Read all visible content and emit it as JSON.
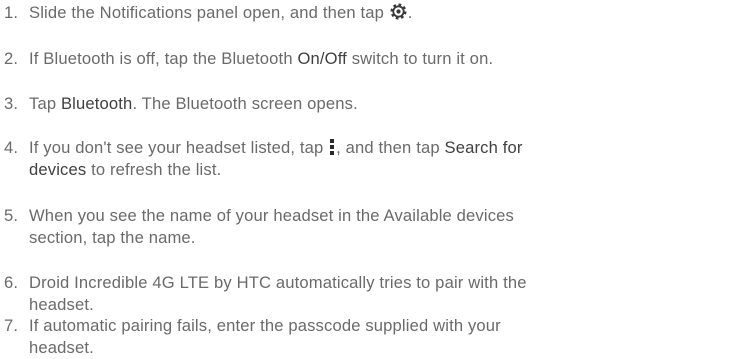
{
  "steps": [
    {
      "number": "1.",
      "parts": [
        "Slide the Notifications panel open, and then tap ",
        "."
      ],
      "icon": "settings-gear-icon"
    },
    {
      "number": "2.",
      "parts": [
        "If Bluetooth is off, tap the Bluetooth ",
        "On/Off",
        " switch to turn it on."
      ]
    },
    {
      "number": "3.",
      "parts": [
        "Tap ",
        "Bluetooth",
        ". The Bluetooth screen opens."
      ]
    },
    {
      "number": "4.",
      "parts": [
        "If you don't see your headset listed, tap ",
        ", and then tap ",
        "Search for",
        "devices",
        " to refresh the list."
      ],
      "icon": "menu-vertical-dots-icon"
    },
    {
      "number": "5.",
      "parts": [
        "When you see the name of your headset in the Available devices",
        "section, tap the name."
      ]
    },
    {
      "number": "6.",
      "parts": [
        "Droid Incredible 4G LTE by HTC automatically tries to pair with the",
        "headset."
      ]
    },
    {
      "number": "7.",
      "parts": [
        "If automatic pairing fails, enter the passcode supplied with your",
        "headset."
      ]
    }
  ]
}
